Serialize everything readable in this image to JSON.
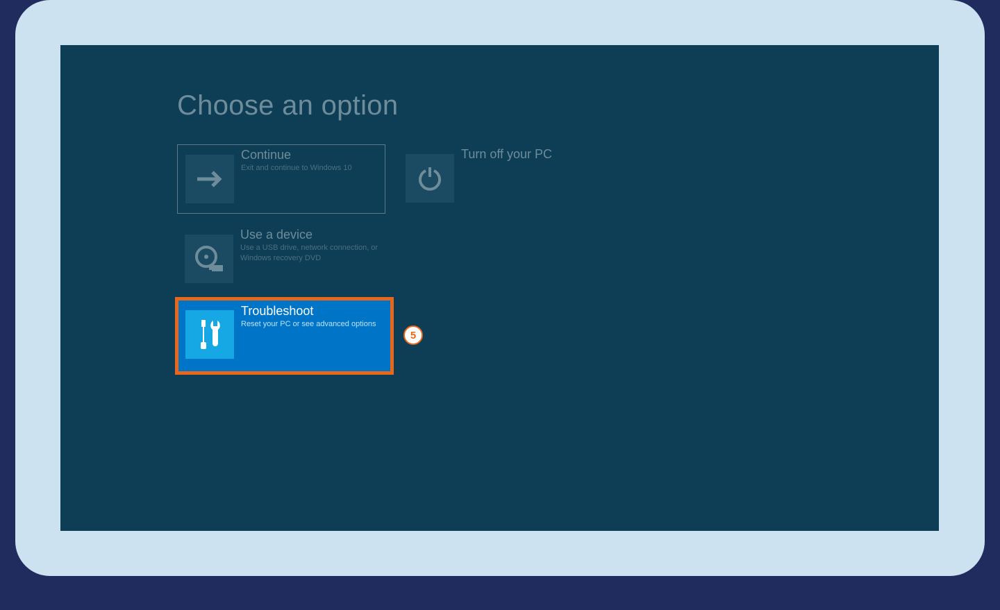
{
  "title": "Choose an option",
  "badge": "5",
  "tiles": {
    "continue": {
      "title": "Continue",
      "sub": "Exit and continue to Windows 10"
    },
    "off": {
      "title": "Turn off your PC",
      "sub": ""
    },
    "usb": {
      "title": "Use a device",
      "sub": "Use a USB drive, network connection, or Windows recovery DVD"
    },
    "trouble": {
      "title": "Troubleshoot",
      "sub": "Reset your PC or see advanced options"
    }
  },
  "colors": {
    "page_bg": "#212c5e",
    "card_bg": "#cde2f0",
    "screen_bg": "#0d3e56",
    "dim_tile": "#1a4b62",
    "dim_text": "#6f8c9a",
    "highlight": "#0075c8",
    "highlight_icon": "#16a8e5",
    "accent": "#e8671b"
  }
}
